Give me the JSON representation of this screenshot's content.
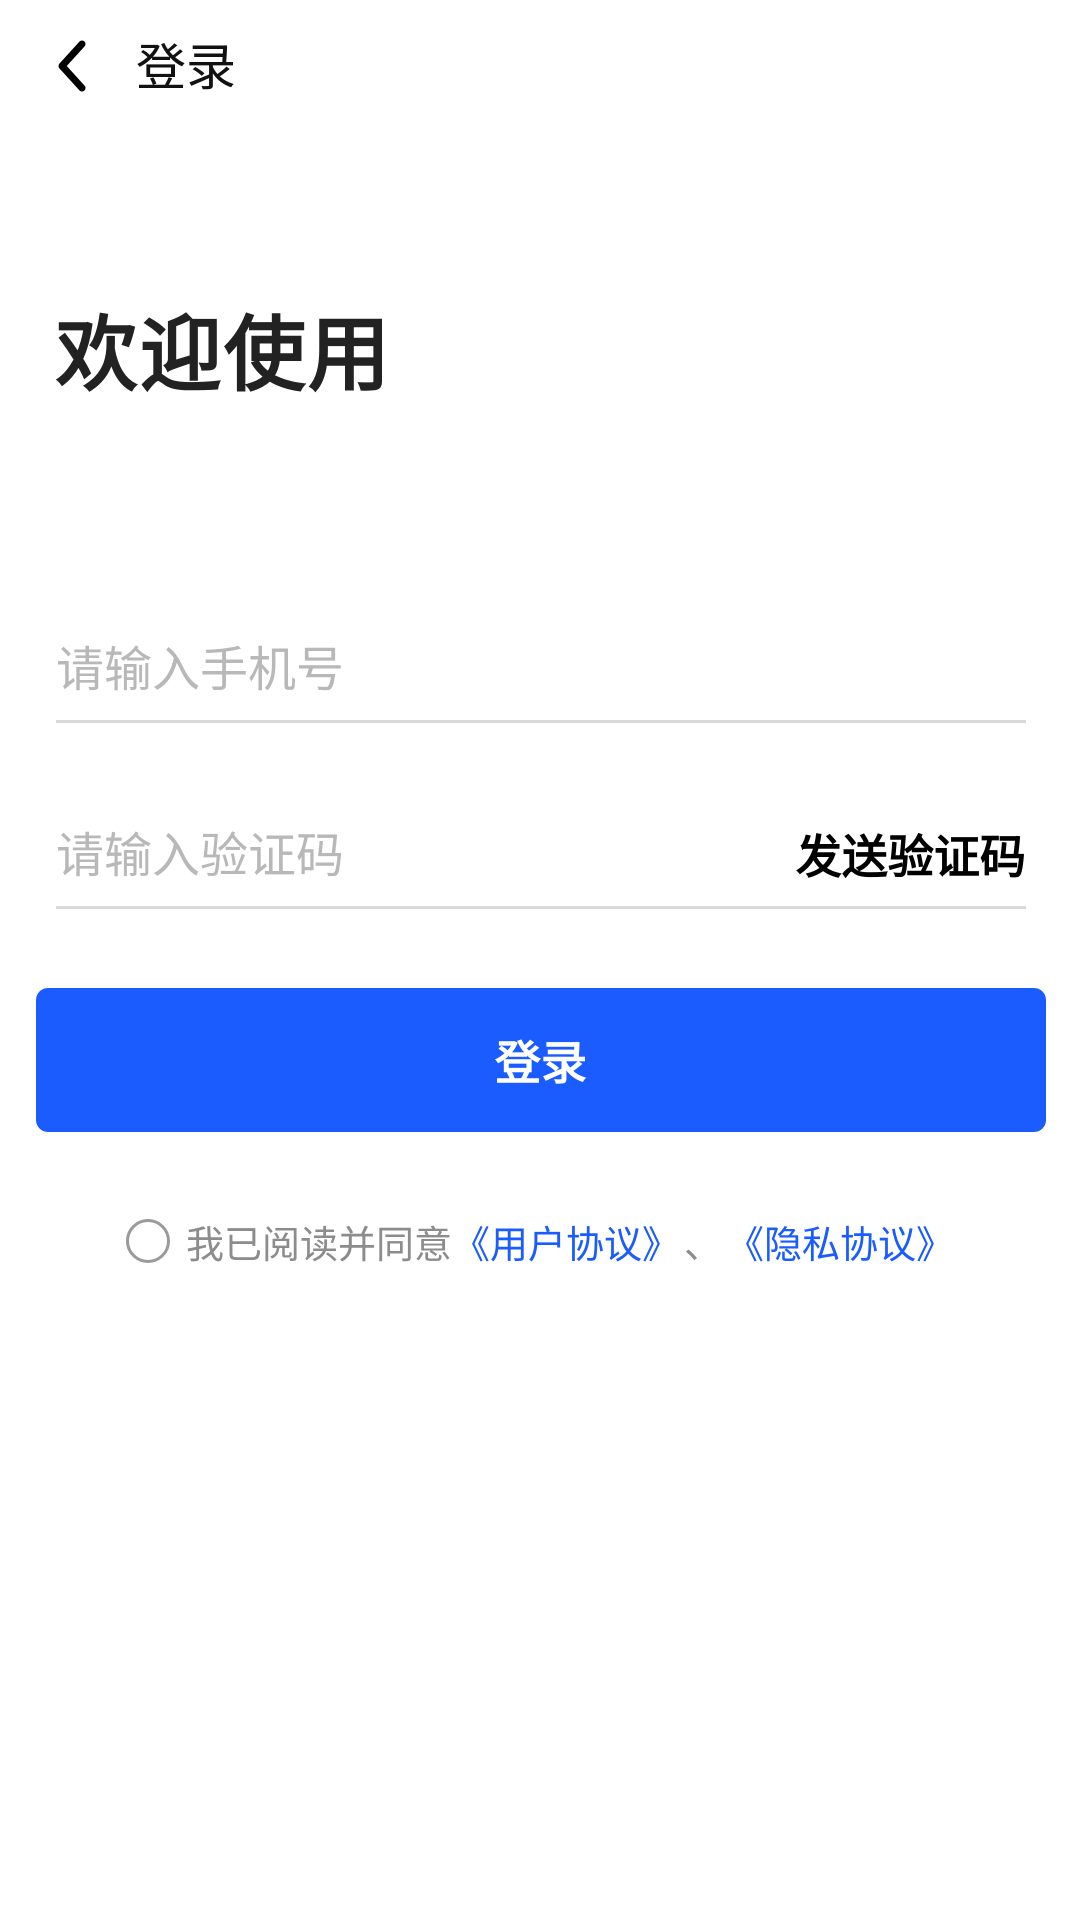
{
  "header": {
    "back_icon": "chevron-left-icon",
    "title": "登录"
  },
  "main": {
    "welcome": "欢迎使用",
    "phone_placeholder": "请输入手机号",
    "phone_value": "",
    "code_placeholder": "请输入验证码",
    "code_value": "",
    "send_code_label": "发送验证码",
    "login_label": "登录"
  },
  "agreement": {
    "checked": false,
    "text": "我已阅读并同意",
    "user_agreement": "《用户协议》",
    "separator": "、",
    "privacy_agreement": "《隐私协议》"
  },
  "colors": {
    "accent": "#1a5cff",
    "placeholder": "#b8b8b8",
    "divider": "#d9d9d9",
    "muted_text": "#8c8c8c"
  }
}
